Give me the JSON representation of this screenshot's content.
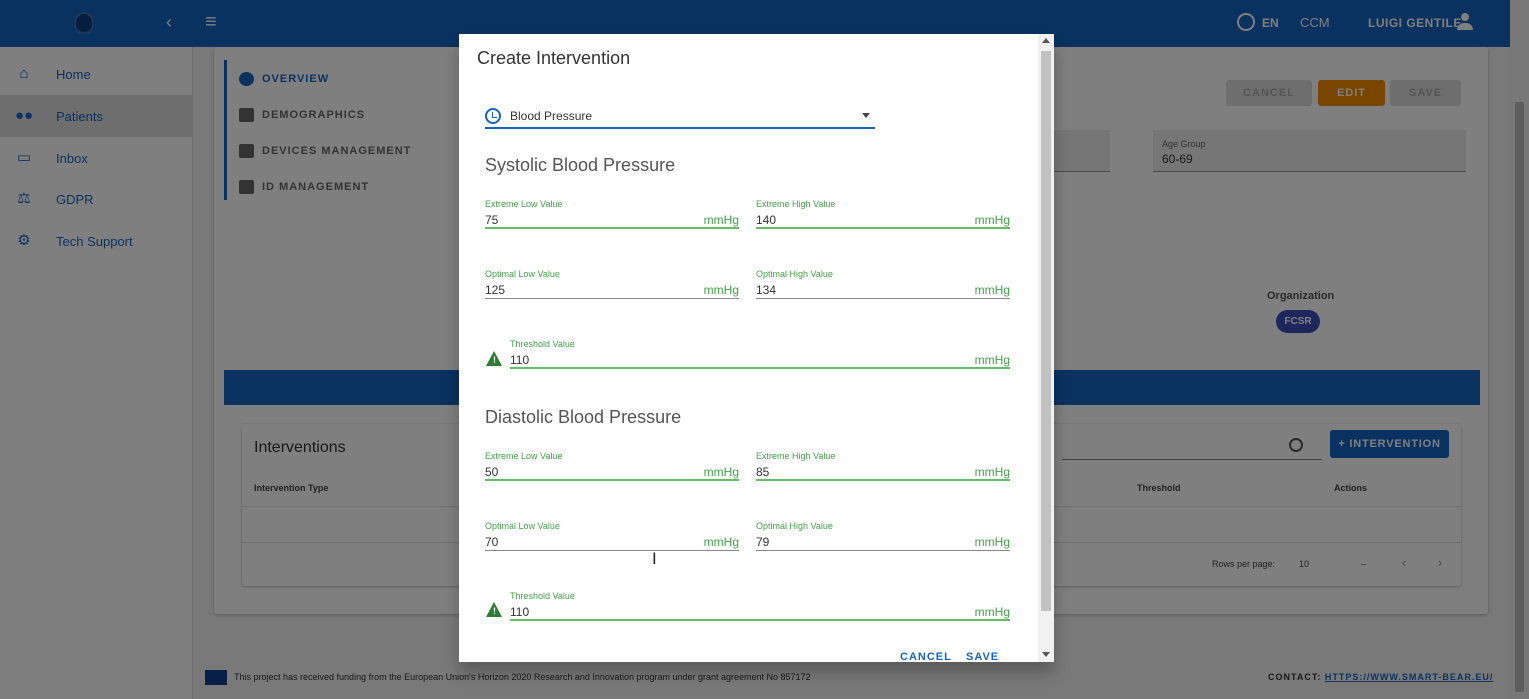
{
  "topbar": {
    "language": "EN",
    "app_code": "CCM",
    "user_name": "LUIGI GENTILE"
  },
  "sidebar": {
    "items": [
      {
        "label": "Home",
        "icon": "home-icon"
      },
      {
        "label": "Patients",
        "icon": "people-icon"
      },
      {
        "label": "Inbox",
        "icon": "inbox-icon"
      },
      {
        "label": "GDPR",
        "icon": "gdpr-icon"
      },
      {
        "label": "Tech Support",
        "icon": "tech-support-icon"
      }
    ]
  },
  "patient_tabs": [
    "OVERVIEW",
    "DEMOGRAPHICS",
    "DEVICES MANAGEMENT",
    "ID MANAGEMENT"
  ],
  "actions": {
    "cancel": "CANCEL",
    "edit": "EDIT",
    "save": "SAVE"
  },
  "age_group": {
    "label": "Age Group",
    "value": "60-69"
  },
  "organization": {
    "label": "Organization",
    "value": "FCSR"
  },
  "interventions": {
    "title": "Interventions",
    "add_button": "+ INTERVENTION",
    "columns": [
      "Intervention Type",
      "Threshold",
      "Actions"
    ],
    "rows_per_page_label": "Rows per page:",
    "rows_per_page": "10",
    "range": "–"
  },
  "footer": {
    "funding": "This project has received funding from the European Union's Horizon 2020 Research and Innovation program under grant agreement No 857172",
    "contact_label": "CONTACT:",
    "contact_link": "HTTPS://WWW.SMART-BEAR.EU/"
  },
  "dialog": {
    "title": "Create Intervention",
    "type_select": "Blood Pressure",
    "systolic": {
      "heading": "Systolic Blood Pressure",
      "extreme_low": {
        "label": "Extreme Low Value",
        "value": "75",
        "unit": "mmHg"
      },
      "extreme_high": {
        "label": "Extreme High Value",
        "value": "140",
        "unit": "mmHg"
      },
      "optimal_low": {
        "label": "Optimal Low Value",
        "value": "125",
        "unit": "mmHg"
      },
      "optimal_high": {
        "label": "Optimal High Value",
        "value": "134",
        "unit": "mmHg"
      },
      "threshold": {
        "label": "Threshold Value",
        "value": "110",
        "unit": "mmHg"
      }
    },
    "diastolic": {
      "heading": "Diastolic Blood Pressure",
      "extreme_low": {
        "label": "Extreme Low Value",
        "value": "50",
        "unit": "mmHg"
      },
      "extreme_high": {
        "label": "Extreme High Value",
        "value": "85",
        "unit": "mmHg"
      },
      "optimal_low": {
        "label": "Optimal Low Value",
        "value": "70",
        "unit": "mmHg"
      },
      "optimal_high": {
        "label": "Optimal High Value",
        "value": "79",
        "unit": "mmHg"
      },
      "threshold": {
        "label": "Threshold Value",
        "value": "110",
        "unit": "mmHg"
      }
    },
    "cancel": "CANCEL",
    "save": "SAVE"
  },
  "colors": {
    "primary": "#1565c0",
    "accent_green": "#43a047",
    "edit_orange": "#f08c00"
  }
}
